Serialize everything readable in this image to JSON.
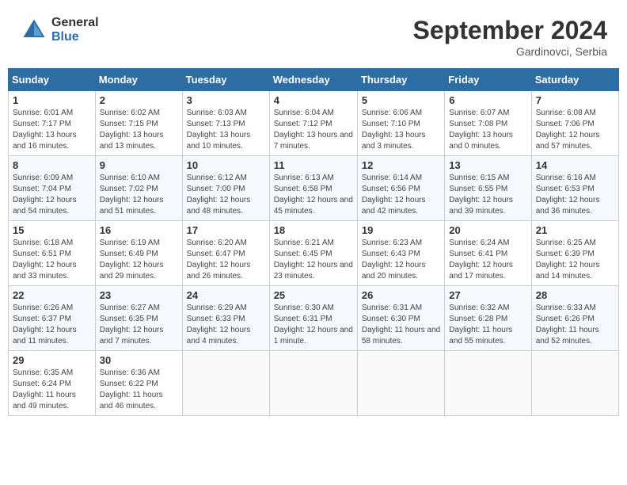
{
  "logo": {
    "general": "General",
    "blue": "Blue"
  },
  "title": "September 2024",
  "location": "Gardinovci, Serbia",
  "days_header": [
    "Sunday",
    "Monday",
    "Tuesday",
    "Wednesday",
    "Thursday",
    "Friday",
    "Saturday"
  ],
  "weeks": [
    [
      {
        "day": "1",
        "sunrise": "6:01 AM",
        "sunset": "7:17 PM",
        "daylight": "13 hours and 16 minutes."
      },
      {
        "day": "2",
        "sunrise": "6:02 AM",
        "sunset": "7:15 PM",
        "daylight": "13 hours and 13 minutes."
      },
      {
        "day": "3",
        "sunrise": "6:03 AM",
        "sunset": "7:13 PM",
        "daylight": "13 hours and 10 minutes."
      },
      {
        "day": "4",
        "sunrise": "6:04 AM",
        "sunset": "7:12 PM",
        "daylight": "13 hours and 7 minutes."
      },
      {
        "day": "5",
        "sunrise": "6:06 AM",
        "sunset": "7:10 PM",
        "daylight": "13 hours and 3 minutes."
      },
      {
        "day": "6",
        "sunrise": "6:07 AM",
        "sunset": "7:08 PM",
        "daylight": "13 hours and 0 minutes."
      },
      {
        "day": "7",
        "sunrise": "6:08 AM",
        "sunset": "7:06 PM",
        "daylight": "12 hours and 57 minutes."
      }
    ],
    [
      {
        "day": "8",
        "sunrise": "6:09 AM",
        "sunset": "7:04 PM",
        "daylight": "12 hours and 54 minutes."
      },
      {
        "day": "9",
        "sunrise": "6:10 AM",
        "sunset": "7:02 PM",
        "daylight": "12 hours and 51 minutes."
      },
      {
        "day": "10",
        "sunrise": "6:12 AM",
        "sunset": "7:00 PM",
        "daylight": "12 hours and 48 minutes."
      },
      {
        "day": "11",
        "sunrise": "6:13 AM",
        "sunset": "6:58 PM",
        "daylight": "12 hours and 45 minutes."
      },
      {
        "day": "12",
        "sunrise": "6:14 AM",
        "sunset": "6:56 PM",
        "daylight": "12 hours and 42 minutes."
      },
      {
        "day": "13",
        "sunrise": "6:15 AM",
        "sunset": "6:55 PM",
        "daylight": "12 hours and 39 minutes."
      },
      {
        "day": "14",
        "sunrise": "6:16 AM",
        "sunset": "6:53 PM",
        "daylight": "12 hours and 36 minutes."
      }
    ],
    [
      {
        "day": "15",
        "sunrise": "6:18 AM",
        "sunset": "6:51 PM",
        "daylight": "12 hours and 33 minutes."
      },
      {
        "day": "16",
        "sunrise": "6:19 AM",
        "sunset": "6:49 PM",
        "daylight": "12 hours and 29 minutes."
      },
      {
        "day": "17",
        "sunrise": "6:20 AM",
        "sunset": "6:47 PM",
        "daylight": "12 hours and 26 minutes."
      },
      {
        "day": "18",
        "sunrise": "6:21 AM",
        "sunset": "6:45 PM",
        "daylight": "12 hours and 23 minutes."
      },
      {
        "day": "19",
        "sunrise": "6:23 AM",
        "sunset": "6:43 PM",
        "daylight": "12 hours and 20 minutes."
      },
      {
        "day": "20",
        "sunrise": "6:24 AM",
        "sunset": "6:41 PM",
        "daylight": "12 hours and 17 minutes."
      },
      {
        "day": "21",
        "sunrise": "6:25 AM",
        "sunset": "6:39 PM",
        "daylight": "12 hours and 14 minutes."
      }
    ],
    [
      {
        "day": "22",
        "sunrise": "6:26 AM",
        "sunset": "6:37 PM",
        "daylight": "12 hours and 11 minutes."
      },
      {
        "day": "23",
        "sunrise": "6:27 AM",
        "sunset": "6:35 PM",
        "daylight": "12 hours and 7 minutes."
      },
      {
        "day": "24",
        "sunrise": "6:29 AM",
        "sunset": "6:33 PM",
        "daylight": "12 hours and 4 minutes."
      },
      {
        "day": "25",
        "sunrise": "6:30 AM",
        "sunset": "6:31 PM",
        "daylight": "12 hours and 1 minute."
      },
      {
        "day": "26",
        "sunrise": "6:31 AM",
        "sunset": "6:30 PM",
        "daylight": "11 hours and 58 minutes."
      },
      {
        "day": "27",
        "sunrise": "6:32 AM",
        "sunset": "6:28 PM",
        "daylight": "11 hours and 55 minutes."
      },
      {
        "day": "28",
        "sunrise": "6:33 AM",
        "sunset": "6:26 PM",
        "daylight": "11 hours and 52 minutes."
      }
    ],
    [
      {
        "day": "29",
        "sunrise": "6:35 AM",
        "sunset": "6:24 PM",
        "daylight": "11 hours and 49 minutes."
      },
      {
        "day": "30",
        "sunrise": "6:36 AM",
        "sunset": "6:22 PM",
        "daylight": "11 hours and 46 minutes."
      },
      null,
      null,
      null,
      null,
      null
    ]
  ]
}
